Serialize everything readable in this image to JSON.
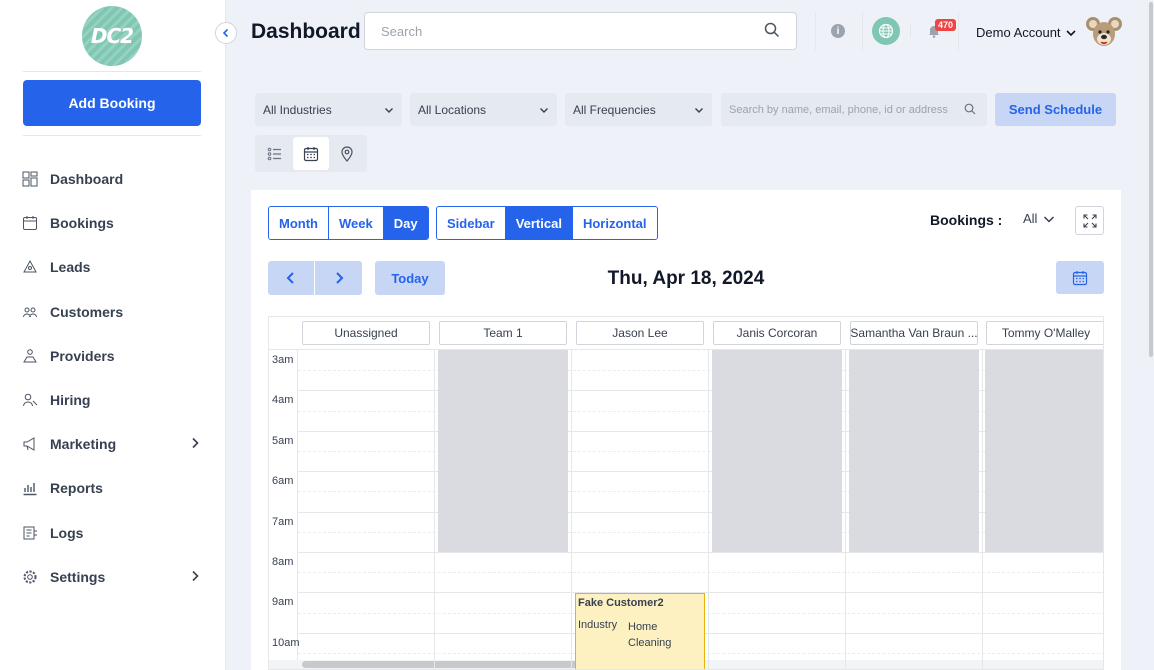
{
  "sidebar": {
    "logo_text": "DC2",
    "add_booking": "Add Booking",
    "items": [
      {
        "label": "Dashboard",
        "icon": "dashboard-icon",
        "has_children": false
      },
      {
        "label": "Bookings",
        "icon": "calendar-icon",
        "has_children": false
      },
      {
        "label": "Leads",
        "icon": "leads-icon",
        "has_children": false
      },
      {
        "label": "Customers",
        "icon": "customers-icon",
        "has_children": false
      },
      {
        "label": "Providers",
        "icon": "providers-icon",
        "has_children": false
      },
      {
        "label": "Hiring",
        "icon": "hiring-icon",
        "has_children": false
      },
      {
        "label": "Marketing",
        "icon": "megaphone-icon",
        "has_children": true
      },
      {
        "label": "Reports",
        "icon": "reports-icon",
        "has_children": false
      },
      {
        "label": "Logs",
        "icon": "logs-icon",
        "has_children": false
      },
      {
        "label": "Settings",
        "icon": "gear-icon",
        "has_children": true
      }
    ]
  },
  "header": {
    "title": "Dashboard",
    "search_placeholder": "Search",
    "notifications_count": "470",
    "account_name": "Demo Account"
  },
  "filters": {
    "industry": "All Industries",
    "location": "All Locations",
    "frequency": "All Frequencies",
    "search_placeholder": "Search by name, email, phone, id or address",
    "send_schedule": "Send Schedule"
  },
  "calendar": {
    "range_options": [
      "Month",
      "Week",
      "Day"
    ],
    "range_active": "Day",
    "layout_options": [
      "Sidebar",
      "Vertical",
      "Horizontal"
    ],
    "layout_active": "Vertical",
    "bookings_label": "Bookings :",
    "bookings_filter": "All",
    "today": "Today",
    "date": "Thu, Apr 18, 2024",
    "columns": [
      "Unassigned",
      "Team 1",
      "Jason Lee",
      "Janis Corcoran",
      "Samantha Van Braun ...",
      "Tommy O'Malley"
    ],
    "time_labels": [
      "3am",
      "4am",
      "5am",
      "6am",
      "7am",
      "8am",
      "9am",
      "10am"
    ],
    "event": {
      "customer": "Fake Customer2",
      "field_label": "Industry",
      "field_value": "Home Cleaning",
      "column": "Jason Lee"
    },
    "colors": {
      "accent": "#2563eb",
      "event_bg": "#fdf1c2",
      "event_border": "#eab308",
      "unavailable": "#d9dbe0"
    }
  }
}
